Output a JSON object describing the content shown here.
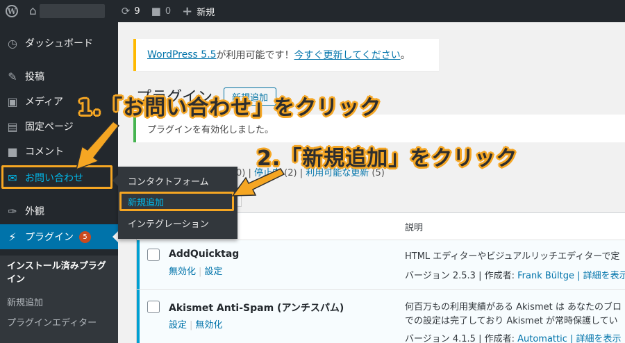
{
  "adminbar": {
    "logo_icon": "wordpress-logo-icon",
    "updates_count": "9",
    "comments_count": "0",
    "new_label": "新規"
  },
  "sidebar": {
    "items": [
      {
        "label": "ダッシュボード",
        "icon": "dashboard-icon"
      },
      {
        "label": "投稿",
        "icon": "pin-icon"
      },
      {
        "label": "メディア",
        "icon": "media-icon"
      },
      {
        "label": "固定ページ",
        "icon": "page-icon"
      },
      {
        "label": "コメント",
        "icon": "comment-icon"
      },
      {
        "label": "お問い合わせ",
        "icon": "mail-icon"
      },
      {
        "label": "外観",
        "icon": "appearance-icon"
      },
      {
        "label": "プラグイン",
        "icon": "plugin-icon",
        "badge": "5"
      }
    ],
    "submenu": {
      "current": "インストール済みプラグイン",
      "add_new": "新規追加",
      "editor": "プラグインエディター"
    }
  },
  "flyout": {
    "items": [
      "コンタクトフォーム",
      "新規追加",
      "インテグレーション"
    ]
  },
  "notice_update": {
    "prefix": "WordPress 5.5",
    "middle": " が利用可能です！",
    "link": "今すぐ更新してください",
    "suffix": "。"
  },
  "page": {
    "title": "プラグイン",
    "add_new_button": "新規追加"
  },
  "notice_success": "プラグインを有効化しました。",
  "filters": {
    "prefix": "0)",
    "inactive": "停止中",
    "inactive_count": "(2)",
    "updates": "利用可能な更新",
    "updates_count": "(5)"
  },
  "table": {
    "desc_header": "説明",
    "rows": [
      {
        "name": "AddQuicktag",
        "action1": "無効化",
        "action2": "設定",
        "desc": "HTML エディターやビジュアルリッチエディターで定",
        "version": "バージョン 2.5.3 | 作成者: ",
        "author": "Frank Bültge",
        "detail": " | 詳細を表示"
      },
      {
        "name": "Akismet Anti-Spam (アンチスパム)",
        "action1": "設定",
        "action2": "無効化",
        "desc": "何百万もの利用実績がある Akismet は あなたのブロ",
        "desc2": "での設定は完了しており Akismet が常時保護してい",
        "version": "バージョン 4.1.5 | 作成者: ",
        "author": "Automattic",
        "detail": " | 詳細を表示"
      }
    ]
  },
  "annotations": {
    "step1": "1.「お問い合わせ」をクリック",
    "step2": "2.「新規追加」をクリック"
  },
  "colors": {
    "accent": "#0073aa",
    "highlight": "#f5a623",
    "sidebar_bg": "#23282d"
  }
}
